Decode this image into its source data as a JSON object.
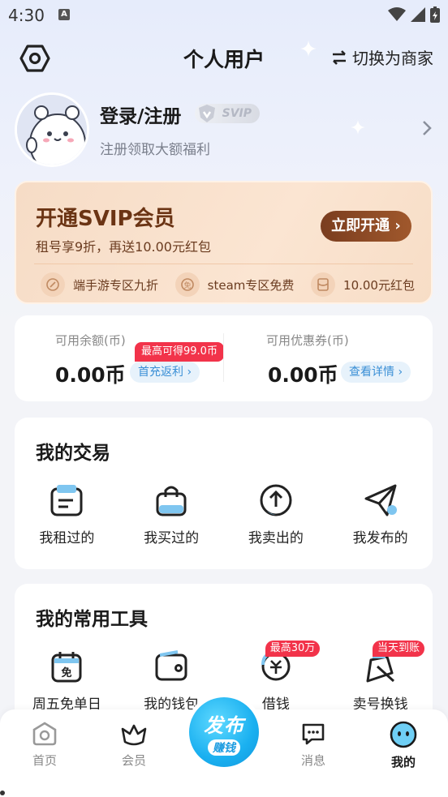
{
  "status": {
    "time": "4:30",
    "notif_letter": "A"
  },
  "header": {
    "title": "个人用户",
    "switch_label": "切换为商家"
  },
  "profile": {
    "login_label": "登录/注册",
    "svip_badge": "SVIP",
    "subtitle": "注册领取大额福利"
  },
  "svip_card": {
    "title": "开通SVIP会员",
    "subtitle": "租号享9折，再送10.00元红包",
    "open_button": "立即开通",
    "perks": [
      {
        "label": "端手游专区九折",
        "icon": "discount-icon"
      },
      {
        "label": "steam专区免费",
        "icon": "free-icon"
      },
      {
        "label": "10.00元红包",
        "icon": "red-packet-icon"
      }
    ]
  },
  "balance": {
    "left": {
      "label": "可用余额(币)",
      "value": "0.00币",
      "tag": "首充返利",
      "hot_tag": "最高可得99.0币"
    },
    "right": {
      "label": "可用优惠券(币)",
      "value": "0.00币",
      "tag": "查看详情"
    }
  },
  "trades": {
    "title": "我的交易",
    "items": [
      {
        "label": "我租过的",
        "icon": "rented-icon"
      },
      {
        "label": "我买过的",
        "icon": "bought-bag-icon"
      },
      {
        "label": "我卖出的",
        "icon": "sold-upload-icon"
      },
      {
        "label": "我发布的",
        "icon": "published-send-icon"
      }
    ]
  },
  "tools": {
    "title": "我的常用工具",
    "items": [
      {
        "label": "周五免单日",
        "icon": "free-day-calendar-icon",
        "tag": ""
      },
      {
        "label": "我的钱包",
        "icon": "wallet-icon",
        "tag": ""
      },
      {
        "label": "借钱",
        "icon": "borrow-money-icon",
        "tag": "最高30万"
      },
      {
        "label": "卖号换钱",
        "icon": "sell-account-icon",
        "tag": "当天到账"
      }
    ]
  },
  "nav": {
    "items": [
      {
        "label": "首页",
        "icon": "home-icon"
      },
      {
        "label": "会员",
        "icon": "member-icon"
      },
      {
        "label": "消息",
        "icon": "message-icon"
      },
      {
        "label": "我的",
        "icon": "me-icon"
      }
    ],
    "publish_main": "发布",
    "publish_sub": "赚钱"
  },
  "colors": {
    "accent": "#1ab0f0",
    "red_tag": "#f2334a",
    "svip_brown": "#6b3414"
  }
}
